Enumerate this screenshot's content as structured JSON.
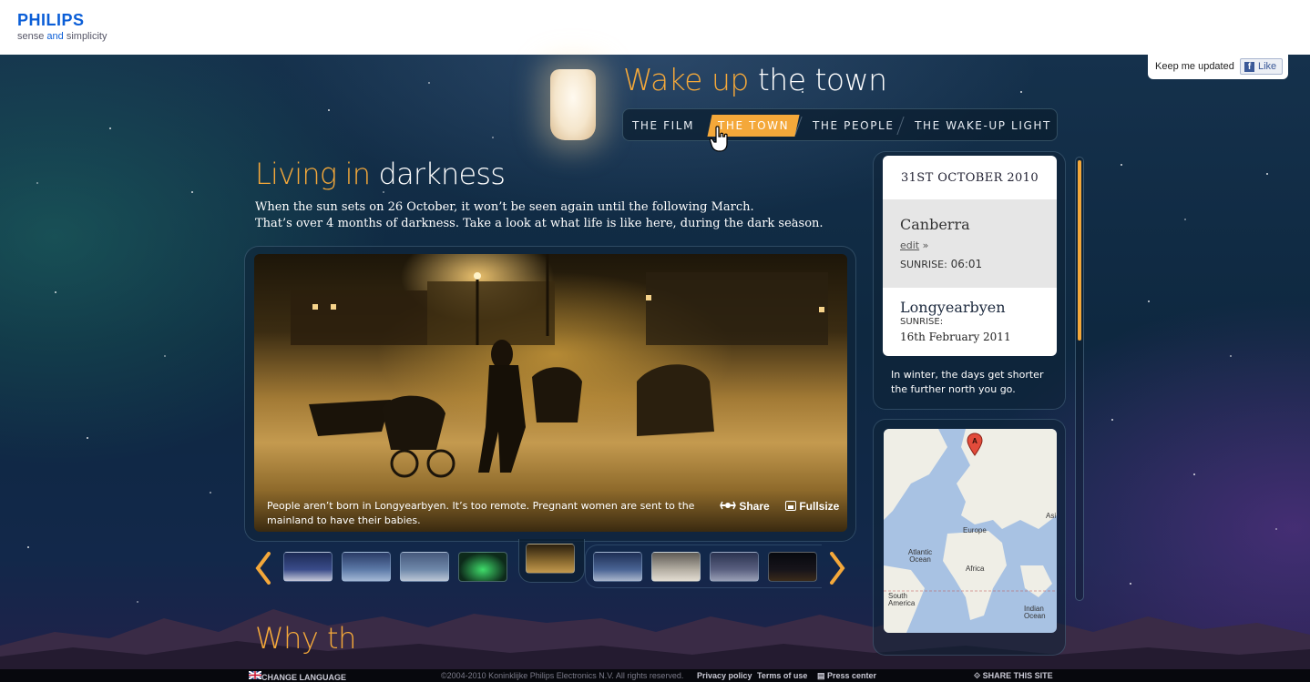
{
  "brand": {
    "name": "PHILIPS",
    "tagline_pre": "sense ",
    "tagline_and": "and",
    "tagline_post": " simplicity"
  },
  "site": {
    "title_accent": "Wake up",
    "title_rest": " the town"
  },
  "nav": {
    "items": [
      {
        "label": "THE FILM",
        "active": false
      },
      {
        "label": "THE TOWN",
        "active": true
      },
      {
        "label": "THE PEOPLE",
        "active": false
      },
      {
        "label": "THE WAKE-UP LIGHT",
        "active": false
      }
    ]
  },
  "facebook": {
    "text": "Keep me updated",
    "like_label": "Like",
    "icon": "f"
  },
  "section": {
    "title_accent": "Living in",
    "title_rest": " darkness",
    "intro_line1": "When the sun sets on 26 October, it won’t be seen again until the following March.",
    "intro_line2": "That’s over 4 months of darkness. Take a look at what life is like here, during the dark season."
  },
  "photo": {
    "caption": "People aren’t born in Longyearbyen. It’s too remote. Pregnant women are sent to the mainland to have their babies.",
    "share_label": "Share",
    "fullsize_label": "Fullsize"
  },
  "thumbnails": {
    "count": 9,
    "active_index": 4
  },
  "next_section": {
    "title_visible": "Why th"
  },
  "sidebar": {
    "date": "31ST OCTOBER 2010",
    "home_city": "Canberra",
    "edit_label": "edit",
    "edit_arrow": " »",
    "home_sunrise_label": "SUNRISE:",
    "home_sunrise_value": " 06:01",
    "remote_city": "Longyearbyen",
    "remote_sunrise_label": "SUNRISE:",
    "remote_sunrise_value": "16th February 2011",
    "note": "In winter, the days get shorter the further north you go."
  },
  "map": {
    "labels": [
      "Europe",
      "Atlantic Ocean",
      "Africa",
      "South America",
      "Indian Ocean",
      "Asi"
    ],
    "marker": "A"
  },
  "footer": {
    "language": "CHANGE LANGUAGE",
    "copyright": "©2004-2010 Koninklijke Philips Electronics N.V.  All rights reserved.",
    "privacy": "Privacy policy",
    "terms": "Terms of use",
    "press": "Press center",
    "share": "SHARE THIS SITE"
  },
  "colors": {
    "accent": "#f4a83a",
    "brand_blue": "#0b5ed7",
    "night": "#0e2840"
  }
}
